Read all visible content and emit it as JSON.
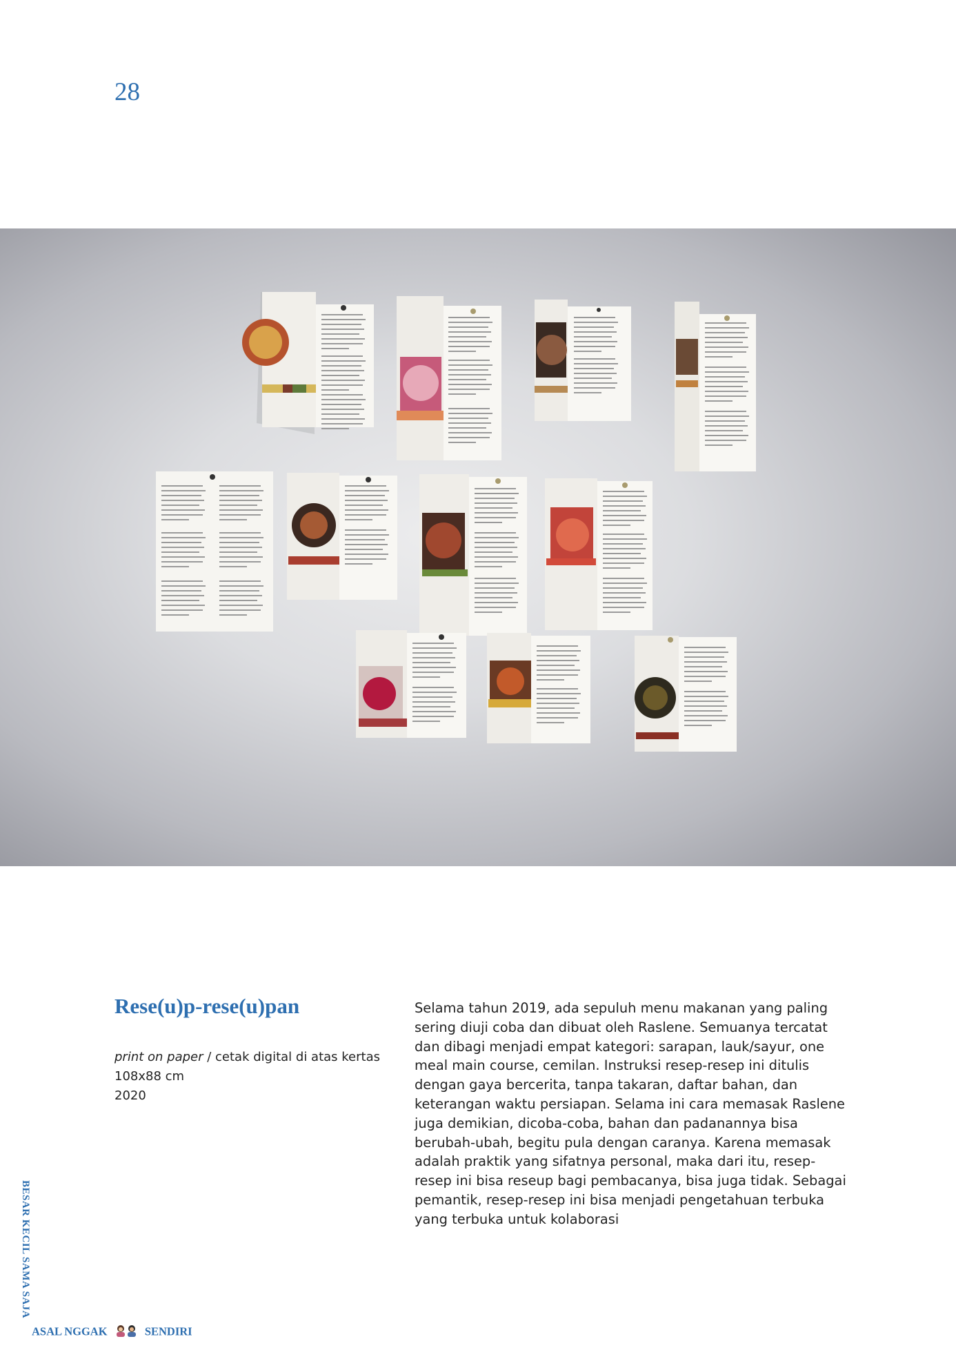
{
  "page_number": "28",
  "artwork": {
    "title": "Rese(u)p-rese(u)pan",
    "medium_en": "print on paper",
    "medium_id": " / cetak digital di atas kertas",
    "dimensions": "108x88 cm",
    "year": "2020"
  },
  "description_lines": [
    "Selama tahun 2019, ada sepuluh menu makanan yang paling",
    "sering diuji coba dan dibuat oleh Raslene. Semuanya tercatat",
    "dan dibagi menjadi empat kategori: sarapan, lauk/sayur, one",
    "meal main course, cemilan. Instruksi resep-resep ini ditulis",
    "dengan gaya bercerita, tanpa takaran, daftar bahan, dan",
    "keterangan waktu persiapan. Selama ini cara memasak Raslene",
    "juga demikian, dicoba-coba, bahan dan padanannya bisa",
    "berubah-ubah, begitu pula dengan caranya. Karena memasak",
    "adalah praktik yang sifatnya personal, maka dari itu, resep-",
    "resep ini bisa reseup bagi pembacanya, bisa juga tidak. Sebagai",
    "pemantik, resep-resep ini bisa menjadi pengetahuan terbuka",
    "yang terbuka untuk kolaborasi"
  ],
  "side_text": "BESAR KECIL SAMA SAJA",
  "footer": {
    "left": "ASAL NGGAK",
    "right": "SENDIRI"
  },
  "colors": {
    "accent": "#2e6fb0",
    "text": "#222222"
  }
}
